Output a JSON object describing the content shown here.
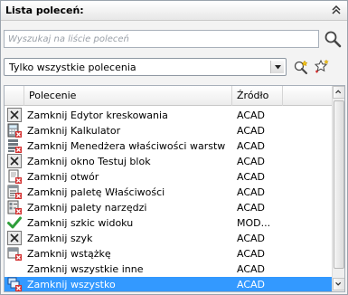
{
  "panel": {
    "title": "Lista poleceń:"
  },
  "search": {
    "placeholder": "Wyszukaj na liście poleceń",
    "value": ""
  },
  "filter": {
    "selected": "Tylko wszystkie polecenia"
  },
  "table": {
    "columns": [
      "Polecenie",
      "Źródło"
    ],
    "rows": [
      {
        "name": "Zamknij Edytor kreskowania",
        "source": "ACAD",
        "icon": "close-x-icon"
      },
      {
        "name": "Zamknij Kalkulator",
        "source": "ACAD",
        "icon": "calculator-close-icon"
      },
      {
        "name": "Zamknij Menedżera właściwości warstw",
        "source": "ACAD",
        "icon": "layers-close-icon"
      },
      {
        "name": "Zamknij okno Testuj blok",
        "source": "ACAD",
        "icon": "close-x-icon"
      },
      {
        "name": "Zamknij otwór",
        "source": "ACAD",
        "icon": "document-close-icon"
      },
      {
        "name": "Zamknij paletę Właściwości",
        "source": "ACAD",
        "icon": "properties-close-icon"
      },
      {
        "name": "Zamknij palety narzędzi",
        "source": "ACAD",
        "icon": "toolpalette-close-icon"
      },
      {
        "name": "Zamknij szkic widoku",
        "source": "MOD...",
        "icon": "checkmark-icon"
      },
      {
        "name": "Zamknij szyk",
        "source": "ACAD",
        "icon": "close-x-icon"
      },
      {
        "name": "Zamknij wstążkę",
        "source": "ACAD",
        "icon": "ribbon-close-icon"
      },
      {
        "name": "Zamknij wszystkie inne",
        "source": "ACAD",
        "icon": ""
      },
      {
        "name": "Zamknij wszystko",
        "source": "ACAD",
        "icon": "windows-close-icon",
        "selected": true
      }
    ]
  }
}
